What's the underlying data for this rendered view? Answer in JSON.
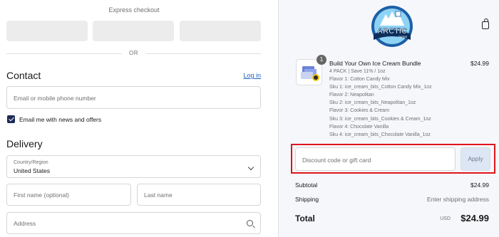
{
  "checkout": {
    "express_title": "Express checkout",
    "divider_or": "OR"
  },
  "contact": {
    "title": "Contact",
    "login_link": "Log in",
    "email_placeholder": "Email or mobile phone number",
    "news_checkbox_label": "Email me with news and offers",
    "news_checked": true
  },
  "delivery": {
    "title": "Delivery",
    "country_label": "Country/Region",
    "country_value": "United States",
    "first_name_placeholder": "First name (optional)",
    "last_name_placeholder": "Last name",
    "address_placeholder": "Address"
  },
  "brand": {
    "logo_text": "ARCTIC",
    "logo_subtext": "FARMS",
    "colors": {
      "primary": "#1d5fa8",
      "light": "#8fd3f4",
      "dark": "#0e2f5c"
    }
  },
  "cart": {
    "quantity": "1",
    "product_title": "Build Your Own Ice Cream Bundle",
    "product_price": "$24.99",
    "variant_lines": [
      "4 PACK | Save 11% / 1oz",
      "Flavor 1: Cotton Candy Mix",
      "Sku 1: ice_cream_bits_Cotton Candy Mix_1oz",
      "Flavor 2: Neapolitan",
      "Sku 2: ice_cream_bits_Neapolitan_1oz",
      "Flavor 3: Cookies & Cream",
      "Sku 3: ice_cream_bits_Cookies & Cream_1oz",
      "Flavor 4: Chocolate Vanilla",
      "Sku 4: ice_cream_bits_Chocolate Vanilla_1oz"
    ]
  },
  "discount": {
    "placeholder": "Discount code or gift card",
    "apply_label": "Apply",
    "highlight_color": "#e0141c"
  },
  "summary": {
    "subtotal_label": "Subtotal",
    "subtotal_value": "$24.99",
    "shipping_label": "Shipping",
    "shipping_value": "Enter shipping address",
    "total_label": "Total",
    "total_currency": "USD",
    "total_value": "$24.99"
  }
}
